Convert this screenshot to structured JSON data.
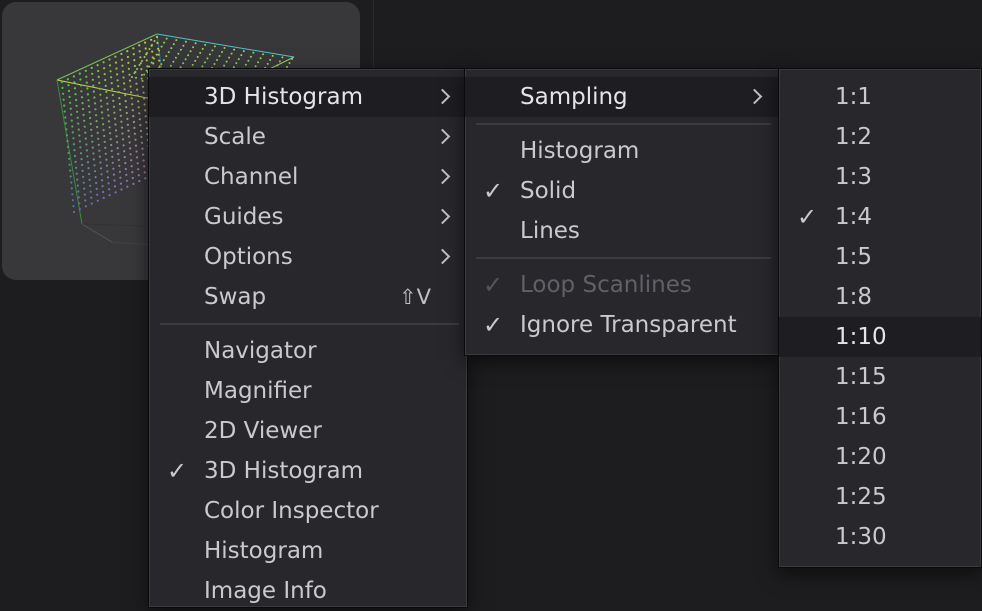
{
  "main_menu": {
    "items": [
      {
        "label": "3D Histogram",
        "submenu": true,
        "active": true
      },
      {
        "label": "Scale",
        "submenu": true
      },
      {
        "label": "Channel",
        "submenu": true
      },
      {
        "label": "Guides",
        "submenu": true
      },
      {
        "label": "Options",
        "submenu": true
      },
      {
        "label": "Swap",
        "shortcut": "⇧V"
      },
      {
        "separator": true
      },
      {
        "label": "Navigator"
      },
      {
        "label": "Magnifier"
      },
      {
        "label": "2D Viewer"
      },
      {
        "label": "3D Histogram",
        "checked": true
      },
      {
        "label": "Color Inspector"
      },
      {
        "label": "Histogram"
      },
      {
        "label": "Image Info"
      }
    ]
  },
  "histogram_menu": {
    "items": [
      {
        "label": "Sampling",
        "submenu": true,
        "active": true
      },
      {
        "separator": true
      },
      {
        "label": "Histogram"
      },
      {
        "label": "Solid",
        "checked": true
      },
      {
        "label": "Lines"
      },
      {
        "separator": true
      },
      {
        "label": "Loop Scanlines",
        "checked": true,
        "disabled": true
      },
      {
        "label": "Ignore Transparent",
        "checked": true
      }
    ]
  },
  "sampling_menu": {
    "items": [
      {
        "label": "1:1"
      },
      {
        "label": "1:2"
      },
      {
        "label": "1:3"
      },
      {
        "label": "1:4",
        "checked": true
      },
      {
        "label": "1:5"
      },
      {
        "label": "1:8"
      },
      {
        "label": "1:10",
        "active": true
      },
      {
        "label": "1:15"
      },
      {
        "label": "1:16"
      },
      {
        "label": "1:20"
      },
      {
        "label": "1:25"
      },
      {
        "label": "1:30"
      }
    ]
  },
  "icons": {
    "check": "✓",
    "submenu_arrow": "chevron-right-icon",
    "shift_key": "shift-icon"
  },
  "colors": {
    "menu_bg": "#28282c",
    "highlight": "#1e1e22",
    "text": "#c9cacd",
    "disabled_text": "#606066"
  }
}
